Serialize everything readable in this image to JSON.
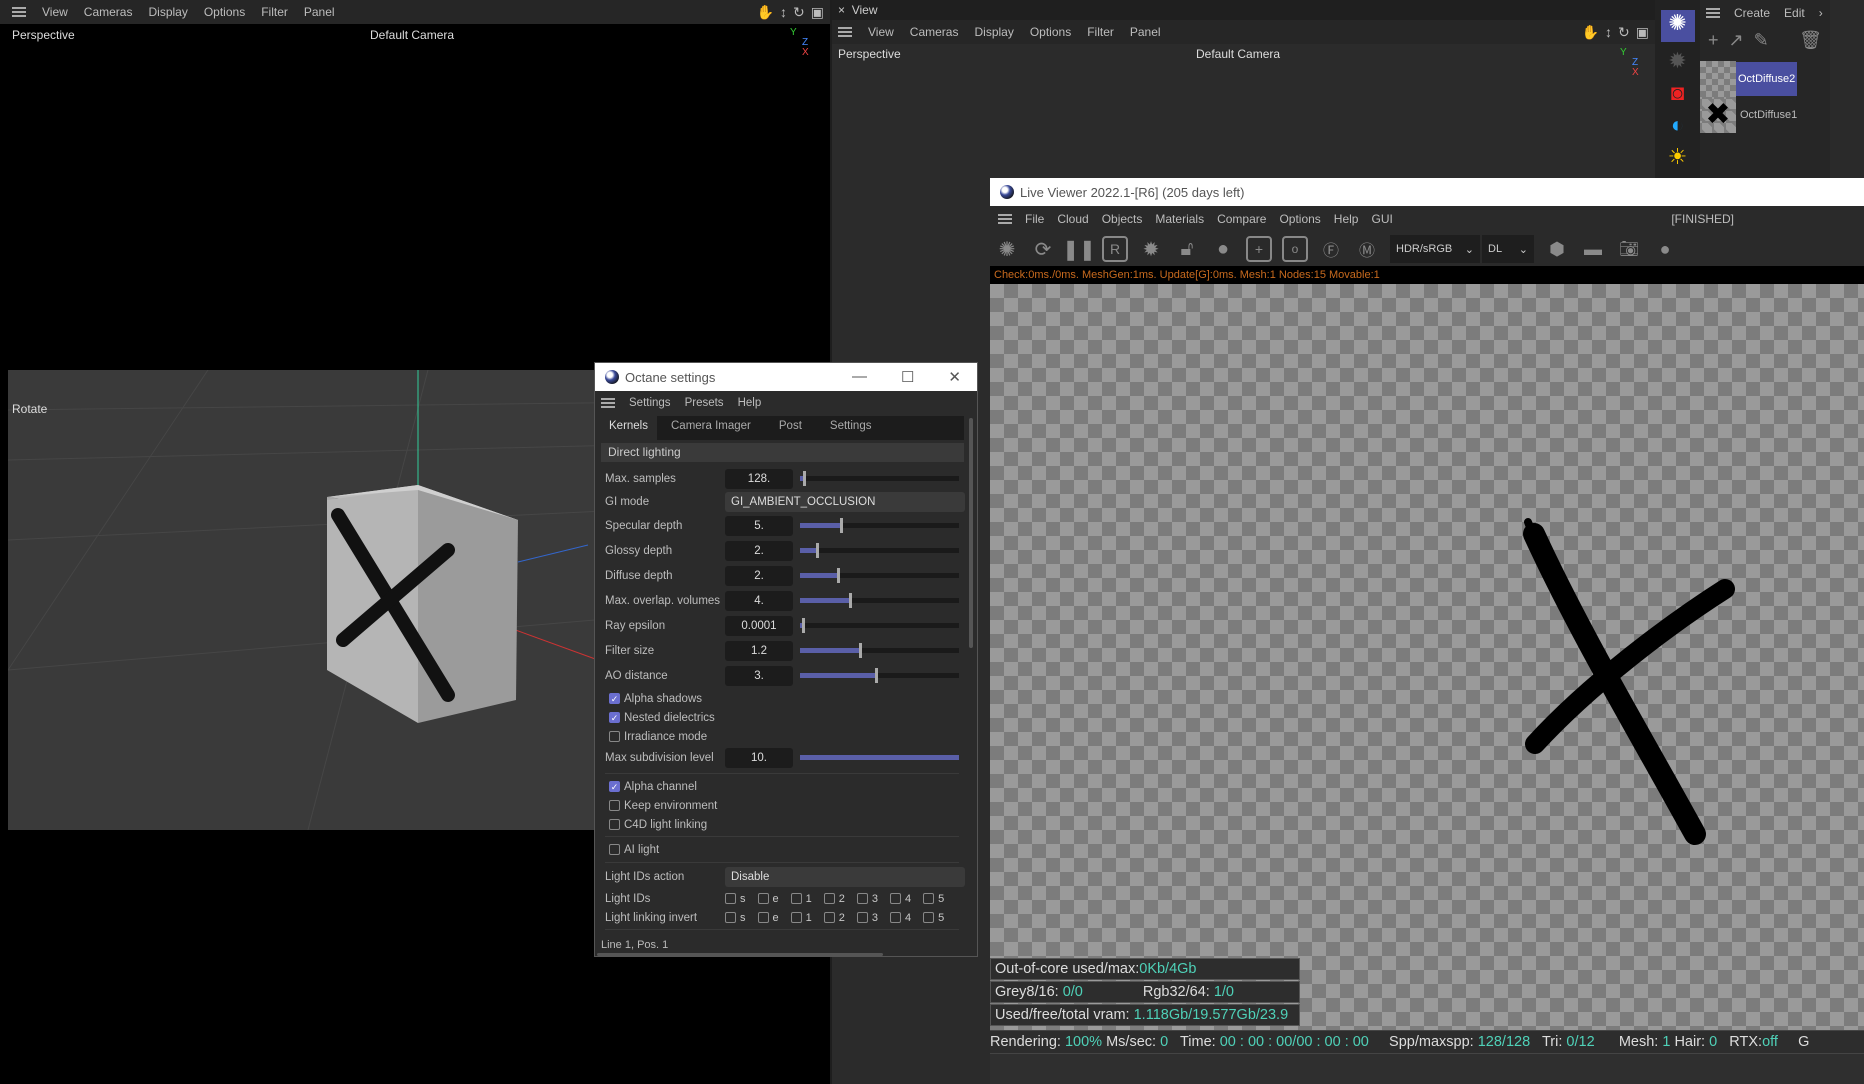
{
  "left_viewport": {
    "menu": [
      "View",
      "Cameras",
      "Display",
      "Options",
      "Filter",
      "Panel"
    ],
    "view_label": "Perspective",
    "camera_label": "Default Camera",
    "mode_label": "Rotate",
    "axis_labels": [
      "Y",
      "Z",
      "X"
    ]
  },
  "right_viewport": {
    "panel_title": "View",
    "menu": [
      "View",
      "Cameras",
      "Display",
      "Options",
      "Filter",
      "Panel"
    ],
    "view_label": "Perspective",
    "camera_label": "Default Camera",
    "axis_labels": [
      "Y",
      "Z",
      "X"
    ]
  },
  "material_manager": {
    "menu": [
      "Create",
      "Edit"
    ],
    "materials": [
      {
        "name": "OctDiffuse2",
        "selected": true
      },
      {
        "name": "OctDiffuse1",
        "selected": false
      }
    ]
  },
  "octane_settings": {
    "title": "Octane settings",
    "menu": [
      "Settings",
      "Presets",
      "Help"
    ],
    "tabs": [
      "Kernels",
      "Camera Imager",
      "Post",
      "Settings"
    ],
    "active_tab": "Kernels",
    "kernel": "Direct lighting",
    "params": [
      {
        "label": "Max. samples",
        "value": "128.",
        "slider": 0.02
      },
      {
        "label": "GI mode",
        "value": "GI_AMBIENT_OCCLUSION"
      },
      {
        "label": "Specular depth",
        "value": "5.",
        "slider": 0.25
      },
      {
        "label": "Glossy depth",
        "value": "2.",
        "slider": 0.1
      },
      {
        "label": "Diffuse depth",
        "value": "2.",
        "slider": 0.23
      },
      {
        "label": "Max. overlap. volumes",
        "value": "4.",
        "slider": 0.31
      },
      {
        "label": "Ray epsilon",
        "value": "0.0001",
        "slider": 0.01
      },
      {
        "label": "Filter size",
        "value": "1.2",
        "slider": 0.37
      },
      {
        "label": "AO distance",
        "value": "3.",
        "slider": 0.47
      }
    ],
    "checks1": [
      {
        "label": "Alpha shadows",
        "checked": true
      },
      {
        "label": "Nested dielectrics",
        "checked": true
      },
      {
        "label": "Irradiance mode",
        "checked": false
      }
    ],
    "max_subdiv": {
      "label": "Max subdivision level",
      "value": "10.",
      "slider": 1.0
    },
    "checks2": [
      {
        "label": "Alpha channel",
        "checked": true
      },
      {
        "label": "Keep environment",
        "checked": false
      },
      {
        "label": "C4D light linking",
        "checked": false
      }
    ],
    "ai_light": {
      "label": "AI light",
      "checked": false
    },
    "light_ids_action": {
      "label": "Light IDs action",
      "value": "Disable"
    },
    "light_ids": {
      "label": "Light IDs",
      "items": [
        "s",
        "e",
        "1",
        "2",
        "3",
        "4",
        "5"
      ]
    },
    "light_linking_invert": {
      "label": "Light linking invert",
      "items": [
        "s",
        "e",
        "1",
        "2",
        "3",
        "4",
        "5"
      ]
    },
    "status": "Line 1, Pos. 1"
  },
  "live_viewer": {
    "title": "Live Viewer 2022.1-[R6] (205 days left)",
    "menu": [
      "File",
      "Cloud",
      "Objects",
      "Materials",
      "Compare",
      "Options",
      "Help",
      "GUI"
    ],
    "state": "[FINISHED]",
    "colorspace": "HDR/sRGB",
    "kernel": "DL",
    "stats_line": "Check:0ms./0ms. MeshGen:1ms. Update[G]:0ms. Mesh:1 Nodes:15 Movable:1",
    "out_of_core": {
      "label": "Out-of-core used/max:",
      "value": "0Kb/4Gb"
    },
    "grey": {
      "label": "Grey8/16:",
      "value": "0/0"
    },
    "rgb": {
      "label": "Rgb32/64:",
      "value": "1/0"
    },
    "vram": {
      "label": "Used/free/total vram:",
      "value": "1.118Gb/19.577Gb/23.9"
    },
    "status": {
      "rendering_label": "Rendering:",
      "rendering": "100%",
      "mssec_label": "Ms/sec:",
      "mssec": "0",
      "time_label": "Time:",
      "time": "00 : 00 : 00/00 : 00 : 00",
      "spp_label": "Spp/maxspp:",
      "spp": "128/128",
      "tri_label": "Tri:",
      "tri": "0/12",
      "mesh_label": "Mesh:",
      "mesh": "1",
      "hair_label": "Hair:",
      "hair": "0",
      "rtx_label": "RTX:",
      "rtx": "off",
      "trail": "G"
    }
  },
  "colors": {
    "accent": "#5a5fa8",
    "cyan_value": "#4fd1b8",
    "stats_orange": "#c86a1e"
  }
}
